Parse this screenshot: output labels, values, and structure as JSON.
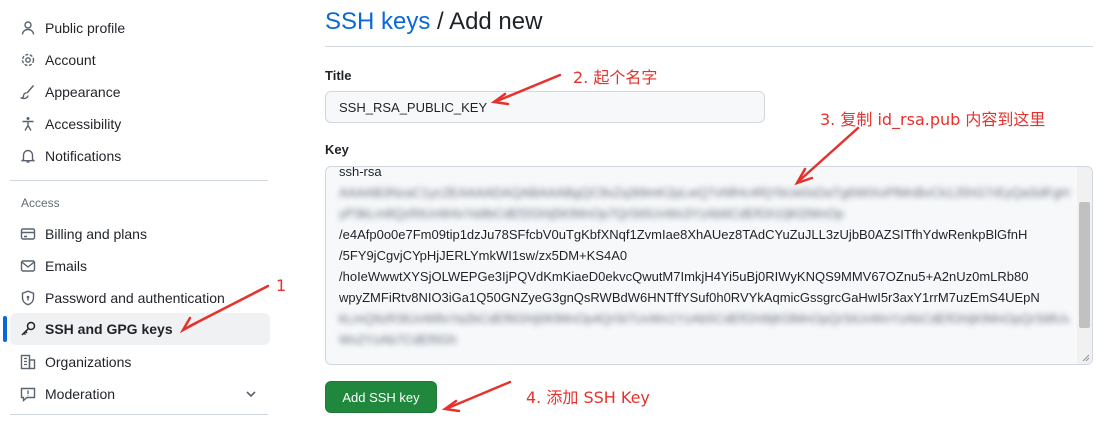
{
  "sidebar": {
    "items": [
      {
        "label": "Public profile",
        "icon": "person-icon"
      },
      {
        "label": "Account",
        "icon": "gear-icon"
      },
      {
        "label": "Appearance",
        "icon": "paintbrush-icon"
      },
      {
        "label": "Accessibility",
        "icon": "accessibility-icon"
      },
      {
        "label": "Notifications",
        "icon": "bell-icon"
      }
    ],
    "section_label": "Access",
    "access_items": [
      {
        "label": "Billing and plans",
        "icon": "credit-card-icon"
      },
      {
        "label": "Emails",
        "icon": "mail-icon"
      },
      {
        "label": "Password and authentication",
        "icon": "shield-lock-icon"
      },
      {
        "label": "SSH and GPG keys",
        "icon": "key-icon",
        "active": true
      },
      {
        "label": "Organizations",
        "icon": "organization-icon"
      },
      {
        "label": "Moderation",
        "icon": "report-icon"
      }
    ]
  },
  "header": {
    "crumb": "SSH keys",
    "separator": " / ",
    "title": "Add new"
  },
  "form": {
    "title_label": "Title",
    "title_value": "SSH_RSA_PUBLIC_KEY",
    "key_label": "Key",
    "key_lines": [
      "ssh-rsa",
      "/e4Afp0o0e7Fm09tip1dzJu78SFfcbV0uTgKbfXNqf1ZvmIae8XhAUez8TAdCYuZuJLL3zUjbB0AZSITfhYdwRenkpBlGfnH",
      "/5FY9jCgvjCYpHjJERLYmkWI1sw/zx5DM+KS4A0",
      "/hoIeWwwtXYSjOLWEPGe3IjPQVdKmKiaeD0ekvcQwutM7ImkjH4Yi5uBj0RIWyKNQS9MMV67OZnu5+A2nUz0mLRb80",
      "wpyZMFiRtv8NIO3iGa1Q50GNZyeG3gnQsRWBdW6HNTffYSuf0h0RVYkAqmicGssgrcGaHwI5r3axY1rrM7uzEmS4UEpN"
    ],
    "submit_label": "Add SSH key"
  },
  "annotations": {
    "a1": "1",
    "a2": "2. 起个名字",
    "a3": "3. 复制 id_rsa.pub 内容到这里",
    "a4": "4. 添加 SSH Key",
    "color": "#e5322d"
  },
  "colors": {
    "accent": "#0969da",
    "primary_button": "#1f883d"
  }
}
